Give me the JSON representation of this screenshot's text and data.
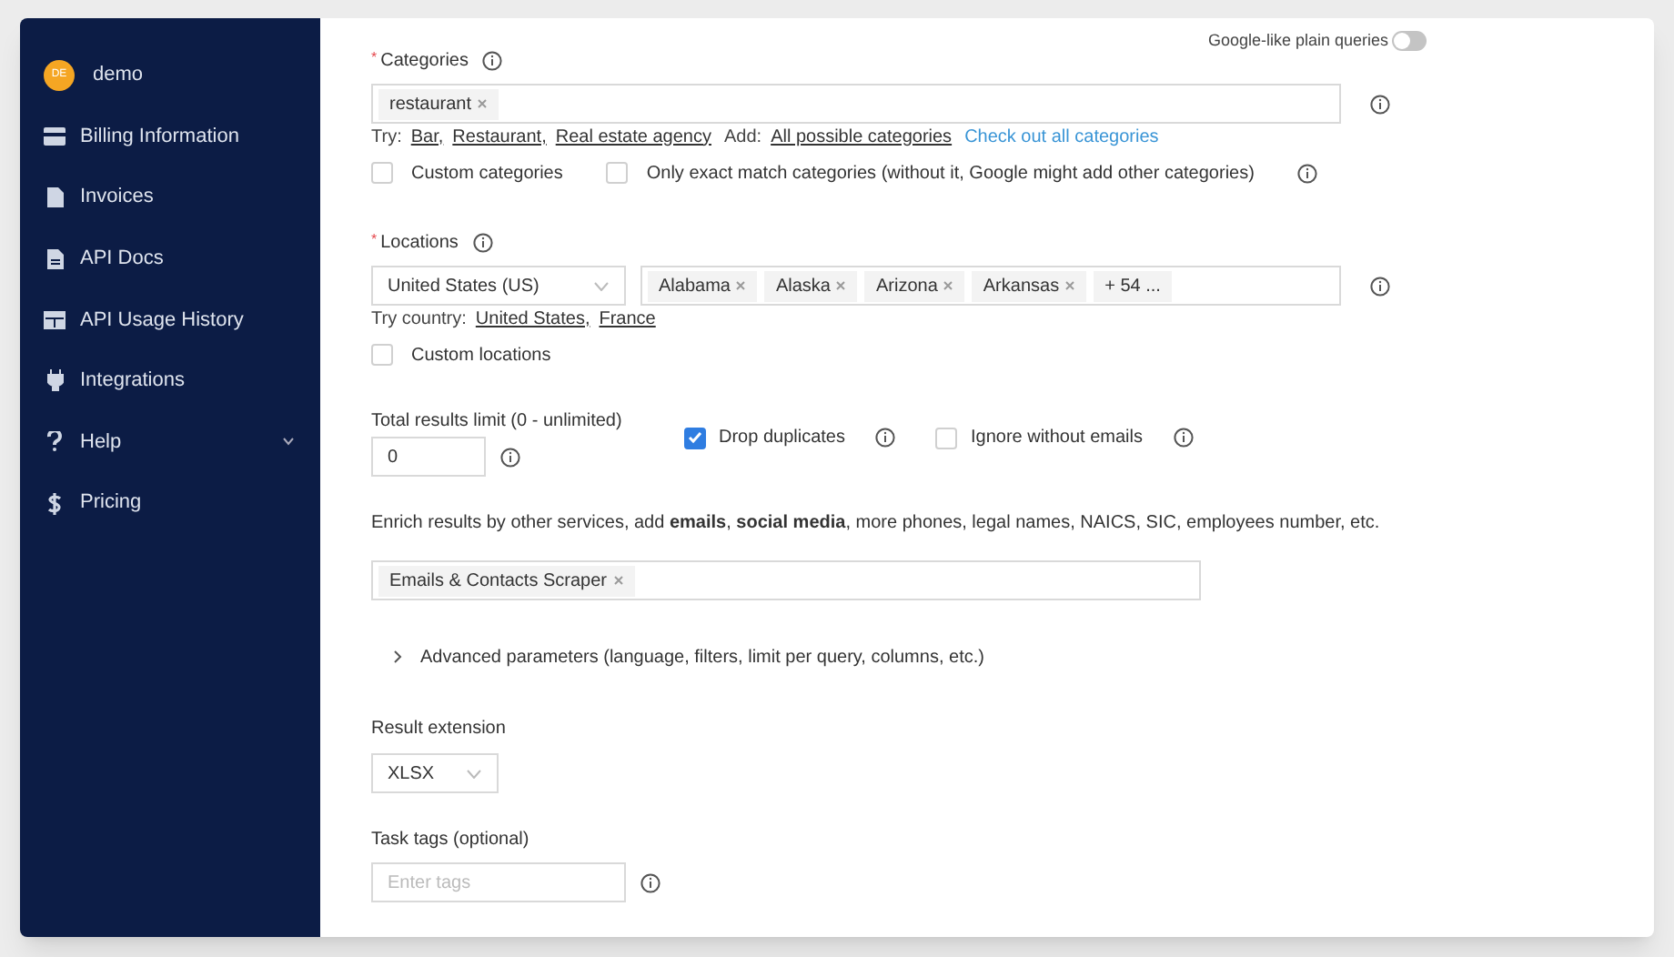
{
  "sidebar": {
    "user": {
      "initials": "DE",
      "name": "demo"
    },
    "items": [
      {
        "label": "Billing Information"
      },
      {
        "label": "Invoices"
      },
      {
        "label": "API Docs"
      },
      {
        "label": "API Usage History"
      },
      {
        "label": "Integrations"
      },
      {
        "label": "Help",
        "expanded": false
      },
      {
        "label": "Pricing"
      }
    ]
  },
  "plain_queries": {
    "label": "Google-like plain queries",
    "on": false
  },
  "categories": {
    "required_mark": "*",
    "label": "Categories",
    "tags": [
      "restaurant"
    ],
    "try_label": "Try:",
    "try": [
      "Bar,",
      "Restaurant,",
      "Real estate agency"
    ],
    "add_label": "Add:",
    "add": "All possible categories",
    "link": "Check out all categories",
    "options": [
      {
        "label": "Custom categories",
        "checked": false,
        "info": false
      },
      {
        "label": "Only exact match categories (without it, Google might add other categories)",
        "checked": false,
        "info": true
      }
    ]
  },
  "locations": {
    "required_mark": "*",
    "label": "Locations",
    "country": "United States (US)",
    "tags": [
      "Alabama",
      "Alaska",
      "Arizona",
      "Arkansas"
    ],
    "more": "+ 54 ...",
    "try_label": "Try country:",
    "try": [
      "United States,",
      "France"
    ],
    "options": [
      {
        "label": "Custom locations",
        "checked": false,
        "info": false
      }
    ]
  },
  "limit": {
    "label": "Total results limit (0 - unlimited)",
    "value": "0"
  },
  "flags": [
    {
      "label": "Drop duplicates",
      "checked": true
    },
    {
      "label": "Ignore without emails",
      "checked": false
    }
  ],
  "enrich": {
    "text": "Enrich results by other services, add **emails**, **social media**, more phones, legal names, NAICS, SIC, employees number, etc.",
    "tags": [
      "Emails & Contacts Scraper"
    ]
  },
  "advanced": {
    "label": "Advanced parameters (language, filters, limit per query, columns, etc.)",
    "expanded": false
  },
  "extension": {
    "label": "Result extension",
    "value": "XLSX"
  },
  "task_tags": {
    "label": "Task tags (optional)",
    "placeholder": "Enter tags"
  }
}
